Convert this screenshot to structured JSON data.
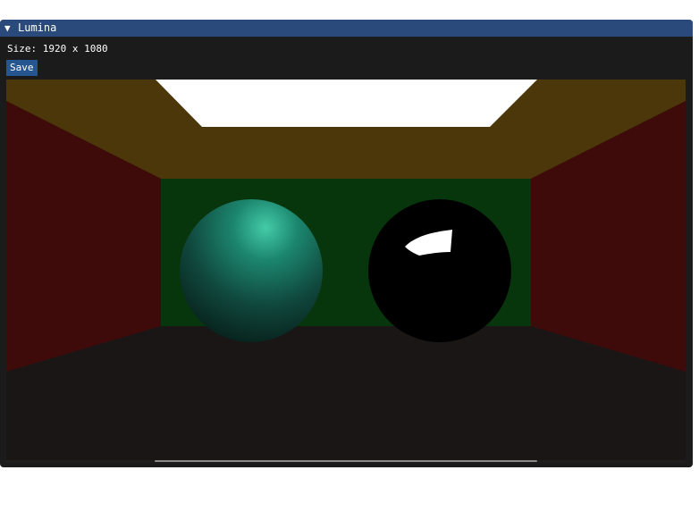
{
  "window": {
    "title": "Lumina",
    "collapse_glyph": "▼"
  },
  "info": {
    "size_label": "Size: 1920 x 1080"
  },
  "toolbar": {
    "save_label": "Save"
  },
  "render": {
    "scene": "cornell-box",
    "colors": {
      "ceiling": "#4c370a",
      "left_wall": "#3f0b0a",
      "right_wall": "#3f0b0a",
      "back_wall": "#08360c",
      "floor": "#1a1616",
      "light": "#ffffff",
      "diffuse_sphere": "#1c6b5c",
      "mirror_sphere": "#000000"
    }
  },
  "horizontal_scroll": {
    "position": 0.5
  }
}
